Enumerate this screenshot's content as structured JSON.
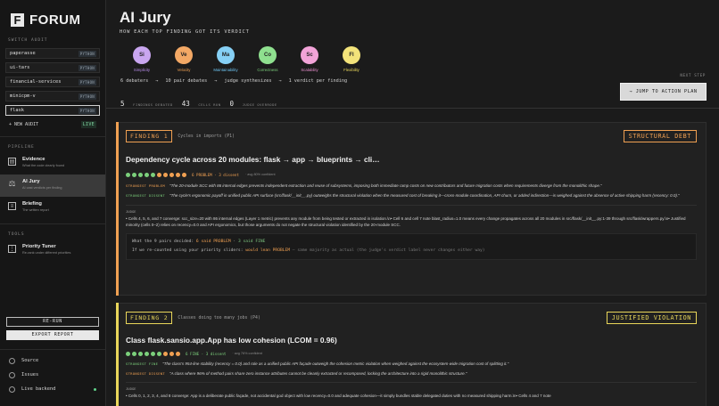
{
  "app": {
    "logo_mark": "F",
    "logo_text": "FORUM"
  },
  "sidebar": {
    "switch_label": "SWITCH AUDIT",
    "audits": [
      {
        "name": "paperasse",
        "tag": "PYTHON"
      },
      {
        "name": "ui-tars",
        "tag": "PYTHON"
      },
      {
        "name": "financial-services",
        "tag": "PYTHON"
      },
      {
        "name": "minicpm-v",
        "tag": "PYTHON"
      },
      {
        "name": "flask",
        "tag": "PYTHON"
      }
    ],
    "new_audit": "+ NEW AUDIT",
    "new_audit_tag": "LIVE",
    "pipeline_label": "PIPELINE",
    "pipeline": [
      {
        "title": "Evidence",
        "sub": "What the code clearly found"
      },
      {
        "title": "AI Jury",
        "sub": "AI cast verdicts per finding"
      },
      {
        "title": "Briefing",
        "sub": "The written report"
      }
    ],
    "tools_label": "TOOLS",
    "tools": [
      {
        "title": "Priority Tuner",
        "sub": "Re-rank under different priorities"
      }
    ],
    "rerun": "RE-RUN",
    "export": "EXPORT REPORT",
    "footer": [
      {
        "label": "Source"
      },
      {
        "label": "Issues"
      },
      {
        "label": "Live backend"
      }
    ]
  },
  "header": {
    "title": "AI Jury",
    "subtitle": "HOW EACH TOP FINDING GOT ITS VERDICT",
    "agents": [
      {
        "abbr": "Si",
        "name": "Simplicity",
        "color": "#c9a6f0",
        "text_color": "#b58ae6"
      },
      {
        "abbr": "Ve",
        "name": "Velocity",
        "color": "#f3a865",
        "text_color": "#f0a052"
      },
      {
        "abbr": "Ma",
        "name": "Maintainability",
        "color": "#86d0f5",
        "text_color": "#6cc2ef"
      },
      {
        "abbr": "Co",
        "name": "Correctness",
        "color": "#8fe08f",
        "text_color": "#7cd07c"
      },
      {
        "abbr": "Sc",
        "name": "Scalability",
        "color": "#f2a3d8",
        "text_color": "#e58ccb"
      },
      {
        "abbr": "Fl",
        "name": "Flexibility",
        "color": "#f3e37a",
        "text_color": "#e9d65a"
      }
    ],
    "pipeline_stats": [
      "6 debaters",
      "→",
      "10 pair debates",
      "→",
      "judge synthesizes",
      "→",
      "1 verdict per finding"
    ],
    "counts": [
      {
        "n": "5",
        "label": "FINDINGS DEBATED"
      },
      {
        "n": "43",
        "label": "CELLS RUN"
      },
      {
        "n": "0",
        "label": "JUDGE OVERRODE"
      }
    ],
    "next_step": "NEXT STEP",
    "jump_button": "→ JUMP TO ACTION PLAN"
  },
  "findings": [
    {
      "badge": "FINDING 1",
      "category": "Cycles in imports (P1)",
      "verdict": "STRUCTURAL DEBT",
      "accent": "#f0a052",
      "title": "Dependency cycle across 20 modules: flask → app → blueprints → cli…",
      "votes": "6 PROBLEM · 3 dissent",
      "vote_color": "#f0a052",
      "confidence": "· avg 80% confident",
      "dots": [
        "#7cd07c",
        "#7cd07c",
        "#7cd07c",
        "#7cd07c",
        "#7cd07c",
        "#f0a052",
        "#f0a052",
        "#f0a052",
        "#f0a052",
        "#f0a052"
      ],
      "arg1_key": "STRONGEST PROBLEM",
      "arg1_key_color": "#f0a052",
      "arg1": "\"The 20-module SCC with 86 internal edges prevents independent extraction and reuse of subsystems, imposing both immediate ramp costs on new contributors and future migration costs when requirements diverge from the monolithic shape.\"",
      "arg2_key": "STRONGEST DISSENT",
      "arg2_key_color": "#7cd07c",
      "arg2": "\"The cycle's ergonomic payoff in unified public API surface (src/flask/__init__.py) outweighs the structural violation when the measured cost of breaking it—cross-module coordination, API churn, or added indirection—is weighed against the absence of active shipping harm (recency: 0.0).\"",
      "judge_label": "JUDGE",
      "judge": "• Cells 4, 5, 6, and 7 converge: scc_size=20 with 86 internal edges (Layer 1 metric) prevents any module from being tested or extracted in isolation.\\n• Cell 6 and cell 7 note blast_radius=1.0 means every change propagates across all 20 modules in src/flask/__init__.py:1-39 through src/flask/wrappers.py.\\n• Justified minority (cells 0–2) relies on recency=0.0 and API ergonomics, but those arguments do not negate the structural violation identified by the 20-module SCC.",
      "pairs_a": "What the 9 pairs decided: ",
      "pairs_b": "6 said PROBLEM",
      "pairs_c": " · ",
      "pairs_d": "3 said FINE",
      "rescore_a": "If we re-counted using your priority sliders: ",
      "rescore_b": "would lean PROBLEM",
      "rescore_c": " — same majority as actual (the judge's verdict label never changes either way)"
    },
    {
      "badge": "FINDING 2",
      "category": "Classes doing too many jobs (P4)",
      "verdict": "JUSTIFIED VIOLATION",
      "accent": "#e9d65a",
      "title": "Class flask.sansio.app.App has low cohesion (LCOM = 0.96)",
      "votes": "6 FINE · 3 dissent",
      "vote_color": "#7cd07c",
      "confidence": "· avg 76% confident",
      "dots": [
        "#7cd07c",
        "#7cd07c",
        "#7cd07c",
        "#7cd07c",
        "#7cd07c",
        "#7cd07c",
        "#f0a052",
        "#f0a052",
        "#f0a052"
      ],
      "arg1_key": "STRONGEST FINE",
      "arg1_key_color": "#7cd07c",
      "arg1": "\"The class's 954-line stability (recency = 0.0) and role as a unified public API façade outweigh the cohesion metric violation when weighed against the ecosystem-wide migration cost of splitting it.\"",
      "arg2_key": "STRONGEST DISSENT",
      "arg2_key_color": "#f0a052",
      "arg2": "\"A class where 96% of method pairs share zero instance attributes cannot be cleanly extracted or recomposed, locking the architecture into a rigid monolithic structure.\"",
      "judge_label": "JUDGE",
      "judge": "• Cells 0, 1, 2, 3, 4, and 8 converge: App is a deliberate public façade, not accidental god object with low recency=0.0 and adequate cohesion—it simply bundles stable delegated duties with no measured shipping harm.\\n• Cells 4 and 7 note"
    }
  ]
}
